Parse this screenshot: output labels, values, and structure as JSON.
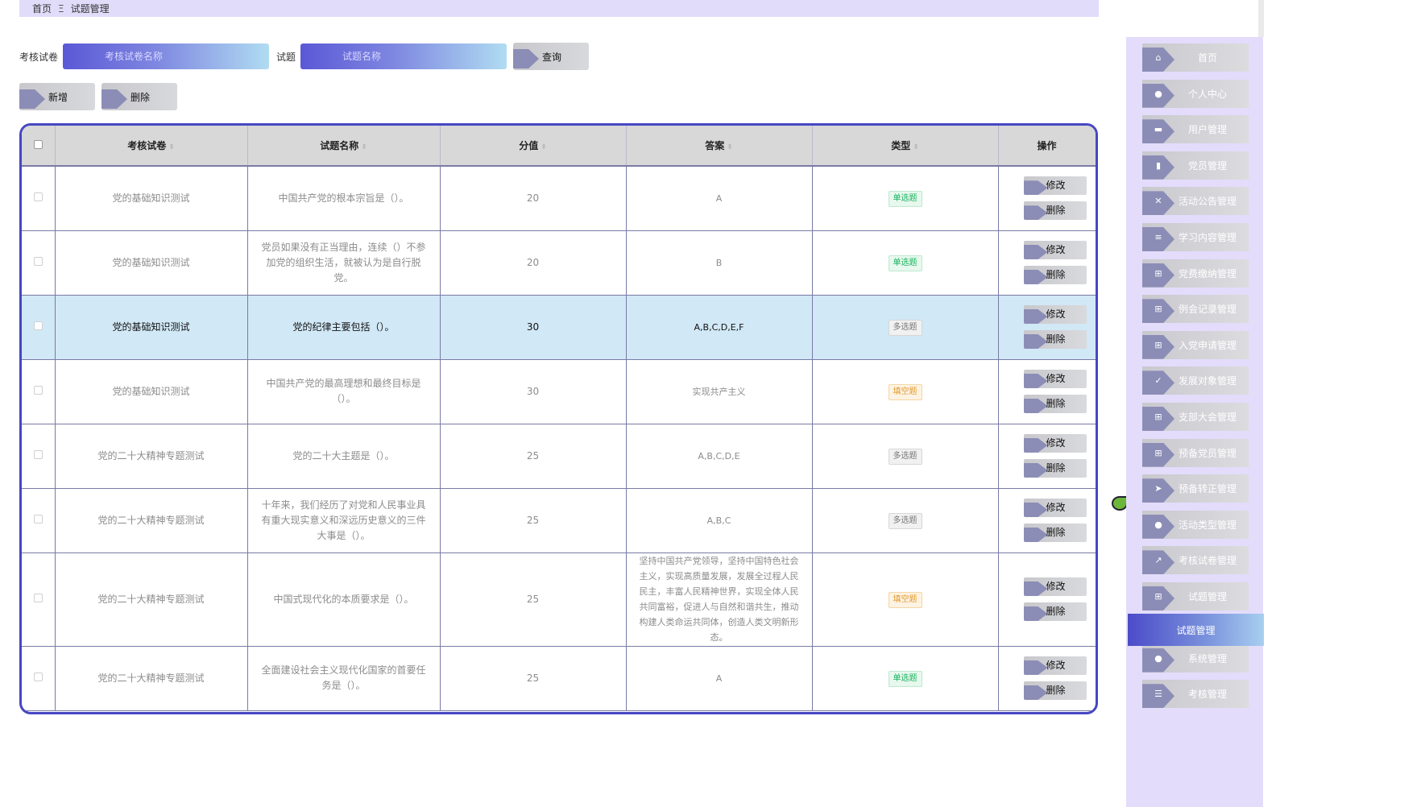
{
  "breadcrumb": {
    "home": "首页",
    "separator": "Ξ",
    "current": "试题管理"
  },
  "search": {
    "paper_label": "考核试卷",
    "paper_placeholder": "考核试卷名称",
    "question_label": "试题",
    "question_placeholder": "试题名称",
    "query_button": "查询"
  },
  "actions": {
    "add_button": "新增",
    "delete_button": "删除"
  },
  "table": {
    "headers": {
      "paper": "考核试卷",
      "question": "试题名称",
      "score": "分值",
      "answer": "答案",
      "type": "类型",
      "ops": "操作"
    },
    "edit_label": "修改",
    "delete_label": "删除",
    "rows": [
      {
        "paper": "党的基础知识测试",
        "question": "中国共产党的根本宗旨是（）。",
        "score": "20",
        "answer": "A",
        "type": "单选题"
      },
      {
        "paper": "党的基础知识测试",
        "question": "党员如果没有正当理由，连续（）不参加党的组织生活，就被认为是自行脱党。",
        "score": "20",
        "answer": "B",
        "type": "单选题"
      },
      {
        "paper": "党的基础知识测试",
        "question": "党的纪律主要包括（）。",
        "score": "30",
        "answer": "A,B,C,D,E,F",
        "type": "多选题"
      },
      {
        "paper": "党的基础知识测试",
        "question": "中国共产党的最高理想和最终目标是（）。",
        "score": "30",
        "answer": "实现共产主义",
        "type": "填空题"
      },
      {
        "paper": "党的二十大精神专题测试",
        "question": "党的二十大主题是（）。",
        "score": "25",
        "answer": "A,B,C,D,E",
        "type": "多选题"
      },
      {
        "paper": "党的二十大精神专题测试",
        "question": "十年来，我们经历了对党和人民事业具有重大现实意义和深远历史意义的三件大事是（）。",
        "score": "25",
        "answer": "A,B,C",
        "type": "多选题"
      },
      {
        "paper": "党的二十大精神专题测试",
        "question": "中国式现代化的本质要求是（）。",
        "score": "25",
        "answer": "坚持中国共产党领导，坚持中国特色社会主义，实现高质量发展，发展全过程人民民主，丰富人民精神世界，实现全体人民共同富裕，促进人与自然和谐共生，推动构建人类命运共同体，创造人类文明新形态。",
        "type": "填空题"
      },
      {
        "paper": "党的二十大精神专题测试",
        "question": "全面建设社会主义现代化国家的首要任务是（）。",
        "score": "25",
        "answer": "A",
        "type": "单选题"
      }
    ]
  },
  "sidebar": {
    "items": [
      {
        "label": "首页",
        "icon": "home-icon"
      },
      {
        "label": "个人中心",
        "icon": "user-icon"
      },
      {
        "label": "用户管理",
        "icon": "monitor-icon"
      },
      {
        "label": "党员管理",
        "icon": "book-icon"
      },
      {
        "label": "活动公告管理",
        "icon": "clipboard-x-icon"
      },
      {
        "label": "学习内容管理",
        "icon": "clipboard-icon"
      },
      {
        "label": "党费缴纳管理",
        "icon": "grid-icon"
      },
      {
        "label": "例会记录管理",
        "icon": "grid-icon"
      },
      {
        "label": "入党申请管理",
        "icon": "grid-icon"
      },
      {
        "label": "发展对象管理",
        "icon": "clipboard-check-icon"
      },
      {
        "label": "支部大会管理",
        "icon": "grid-icon"
      },
      {
        "label": "预备党员管理",
        "icon": "grid-icon"
      },
      {
        "label": "预备转正管理",
        "icon": "send-icon"
      },
      {
        "label": "活动类型管理",
        "icon": "user-icon"
      },
      {
        "label": "考核试卷管理",
        "icon": "chart-icon"
      },
      {
        "label": "试题管理",
        "icon": "grid-icon"
      },
      {
        "label": "系统管理",
        "icon": "user-icon"
      },
      {
        "label": "考核管理",
        "icon": "list-icon"
      }
    ],
    "active_label": "试题管理"
  },
  "colors": {
    "accent": "#4747c2",
    "breadcrumb_bg": "#e2dcfb",
    "highlight_row": "#d1e8f6",
    "tag_single": "#19b35e",
    "tag_fill": "#e39a2b"
  }
}
